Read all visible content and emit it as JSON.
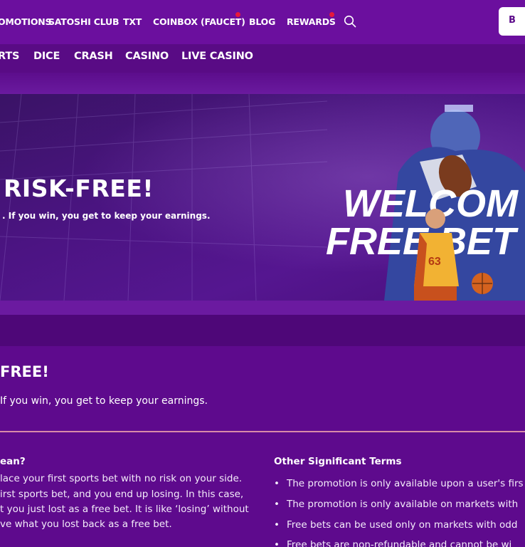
{
  "top_nav": {
    "items": [
      {
        "label": "OMOTIONS"
      },
      {
        "label": "SATOSHI CLUB"
      },
      {
        "label": "TXT"
      },
      {
        "label": "COINBOX (FAUCET)"
      },
      {
        "label": "BLOG"
      },
      {
        "label": "REWARDS"
      }
    ],
    "notification_color": "#e6183c",
    "right_button_label": "B"
  },
  "sub_nav": {
    "items": [
      {
        "label": "RTS"
      },
      {
        "label": "DICE"
      },
      {
        "label": "CRASH"
      },
      {
        "label": "CASINO"
      },
      {
        "label": "LIVE CASINO"
      }
    ]
  },
  "hero": {
    "title": "RISK-FREE!",
    "subtitle": ". If you win, you get to keep your earnings.",
    "banner_line1": "WELCOM",
    "banner_line2": "FREE BET",
    "jersey_number": "63"
  },
  "content": {
    "title": "FREE!",
    "subtitle": "If you win, you get to keep your earnings.",
    "left_heading": "ean?",
    "left_paragraph": [
      "lace your first sports bet with no risk on your side.",
      "irst sports bet, and you end up losing. In this case,",
      "t you just lost as a free bet. It is like ‘losing’ without",
      "ve what you lost back as a free bet."
    ],
    "right_heading": "Other Significant Terms",
    "terms": [
      "The promotion is only available upon a user's firs",
      "The promotion is only available on markets with",
      "Free bets can be used only on markets with odd",
      "Free bets are non-refundable and cannot be wi"
    ]
  },
  "colors": {
    "brand_purple": "#5c0a8a",
    "nav_purple": "#6b0f9e",
    "divider_pink": "#d98aa8"
  }
}
